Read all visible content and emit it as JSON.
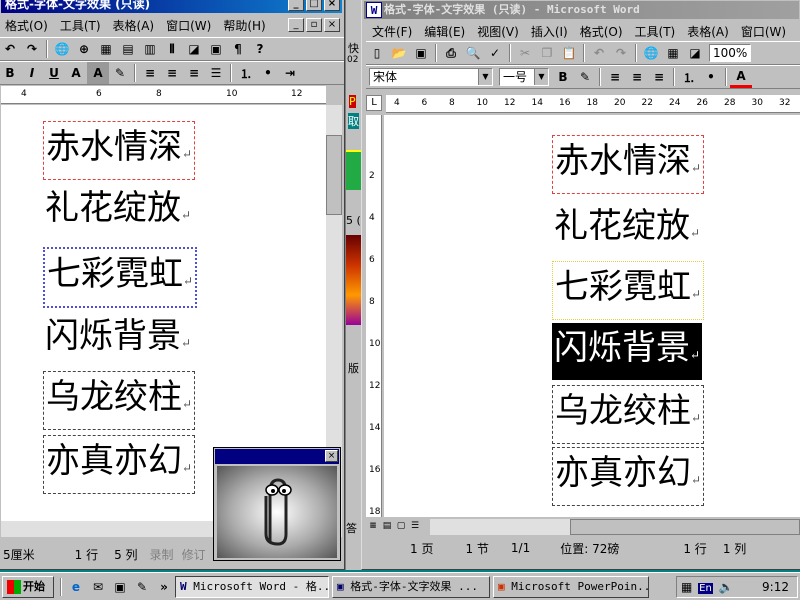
{
  "left_window": {
    "title": "格式-字体-文字效果 (只读)",
    "menu": [
      "格式(O)",
      "工具(T)",
      "表格(A)",
      "窗口(W)",
      "帮助(H)"
    ],
    "ruler_ticks": [
      "4",
      "6",
      "8",
      "10",
      "12"
    ],
    "words": [
      "赤水情深",
      "礼花绽放",
      "七彩霓虹",
      "闪烁背景",
      "乌龙绞柱",
      "亦真亦幻"
    ],
    "status": {
      "position": "5厘米",
      "line": "1 行",
      "col": "5 列",
      "rec": "录制",
      "rev": "修订"
    }
  },
  "right_window": {
    "title": "格式-字体-文字效果 (只读) - Microsoft Word",
    "menu": [
      "文件(F)",
      "编辑(E)",
      "视图(V)",
      "插入(I)",
      "格式(O)",
      "工具(T)",
      "表格(A)",
      "窗口(W)"
    ],
    "font_name": "宋体",
    "font_size": "一号",
    "zoom": "100%",
    "ruler_ticks": [
      "4",
      "6",
      "8",
      "10",
      "12",
      "14",
      "16",
      "18",
      "20",
      "22",
      "24",
      "26",
      "28",
      "30",
      "32"
    ],
    "vruler_ticks": [
      "2",
      "4",
      "6",
      "8",
      "10",
      "12",
      "14",
      "16",
      "18"
    ],
    "words": [
      "赤水情深",
      "礼花绽放",
      "七彩霓虹",
      "闪烁背景",
      "乌龙绞柱",
      "亦真亦幻"
    ],
    "status": {
      "page": "1 页",
      "section": "1 节",
      "pages": "1/1",
      "position": "位置: 72磅",
      "line": "1 行",
      "col": "1 列"
    }
  },
  "middle_strip": {
    "labels": [
      "快",
      "02",
      "P",
      "取",
      "5 (",
      "版",
      "答"
    ]
  },
  "office_assistant": {
    "close": "×"
  },
  "paragraph_mark": "↵",
  "taskbar": {
    "start": "开始",
    "buttons": [
      "Microsoft Word - 格...",
      "格式-字体-文字效果 ...",
      "Microsoft PowerPoin..."
    ],
    "tray_lang": "En",
    "clock": "9:12"
  },
  "colors": {
    "title_active": "#000080",
    "title_inactive": "#808080",
    "selection": "#000000",
    "red_dash": "#e04040"
  }
}
